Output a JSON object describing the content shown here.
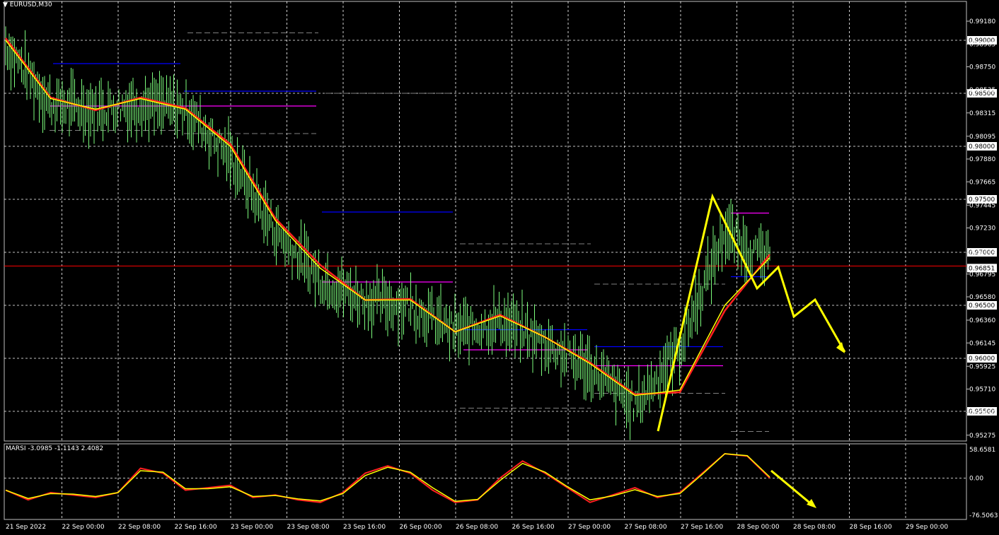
{
  "main_chart": {
    "symbol_label": "EURUSD,M30",
    "colors": {
      "background": "#000000",
      "grid": "#ffffff",
      "candles": "#7cfc7c",
      "ma_fast": "#ffff00",
      "ma_slow": "#ff2020",
      "level_blue": "#0000ff",
      "level_magenta": "#ff00ff",
      "level_grey": "#808080",
      "price_line": "#ff0000",
      "annotation": "#ffff00"
    }
  },
  "chart_data": [
    {
      "type": "line",
      "name": "EURUSD M30 price",
      "x": [
        "21 Sep 2022",
        "22 Sep 00:00",
        "22 Sep 08:00",
        "22 Sep 16:00",
        "23 Sep 00:00",
        "23 Sep 08:00",
        "23 Sep 16:00",
        "26 Sep 00:00",
        "26 Sep 08:00",
        "26 Sep 16:00",
        "27 Sep 00:00",
        "27 Sep 08:00",
        "27 Sep 16:00",
        "28 Sep 00:00",
        "28 Sep 08:00",
        "28 Sep 16:00",
        "29 Sep 00:00"
      ],
      "series": [
        {
          "values": [
            0.9895,
            0.984,
            0.9835,
            0.984,
            0.9835,
            0.979,
            0.972,
            0.9675,
            0.9655,
            0.965,
            0.9625,
            0.9635,
            0.9615,
            0.959,
            0.9555,
            0.961,
            0.972,
            0.969
          ]
        },
        {
          "values": [
            0.99,
            0.9845,
            0.9835,
            0.9845,
            0.9835,
            0.98,
            0.973,
            0.9685,
            0.9655,
            0.9655,
            0.9625,
            0.964,
            0.962,
            0.9595,
            0.9565,
            0.957,
            0.965,
            0.9695
          ]
        },
        {
          "values": [
            0.9902,
            0.9846,
            0.9834,
            0.9846,
            0.9836,
            0.9802,
            0.9732,
            0.9688,
            0.9655,
            0.9656,
            0.9625,
            0.9641,
            0.962,
            0.9596,
            0.9566,
            0.9568,
            0.9645,
            0.9698
          ]
        }
      ],
      "ylim": [
        0.9522,
        0.993
      ],
      "y_ticks": [
        "0.99180",
        "0.98965",
        "0.98750",
        "0.98535",
        "0.98315",
        "0.98095",
        "0.97880",
        "0.97665",
        "0.97445",
        "0.97230",
        "0.96995",
        "0.96795",
        "0.96580",
        "0.96360",
        "0.96145",
        "0.95925",
        "0.95710",
        "0.95490",
        "0.95275"
      ],
      "price_labels": [
        "0.99000",
        "0.98500",
        "0.98000",
        "0.97500",
        "0.97000",
        "0.96500",
        "0.96000",
        "0.95500"
      ],
      "current_price": "0.96851",
      "grid": true
    },
    {
      "type": "line",
      "title": "MARSI -3.0985 -1.1143 2.4082",
      "series": [
        {
          "values": [
            -25,
            -45,
            -30,
            -35,
            -40,
            -30,
            20,
            10,
            -25,
            -20,
            -15,
            -40,
            -35,
            -45,
            -50,
            -30,
            10,
            25,
            10,
            -25,
            -50,
            -45,
            0,
            35,
            10,
            -20,
            -50,
            -35,
            -20,
            -40,
            -30,
            10,
            50,
            45,
            0
          ]
        },
        {
          "values": [
            -25,
            -42,
            -32,
            -33,
            -38,
            -30,
            15,
            12,
            -22,
            -22,
            -18,
            -38,
            -36,
            -43,
            -47,
            -32,
            5,
            22,
            12,
            -20,
            -48,
            -44,
            -5,
            30,
            12,
            -18,
            -45,
            -37,
            -24,
            -38,
            -32,
            8,
            50,
            46,
            2
          ]
        }
      ],
      "ylim": [
        -76.5063,
        58.6581
      ],
      "y_ticks": [
        "58.6581",
        "0.00",
        "-76.5063"
      ],
      "grid": true
    }
  ]
}
